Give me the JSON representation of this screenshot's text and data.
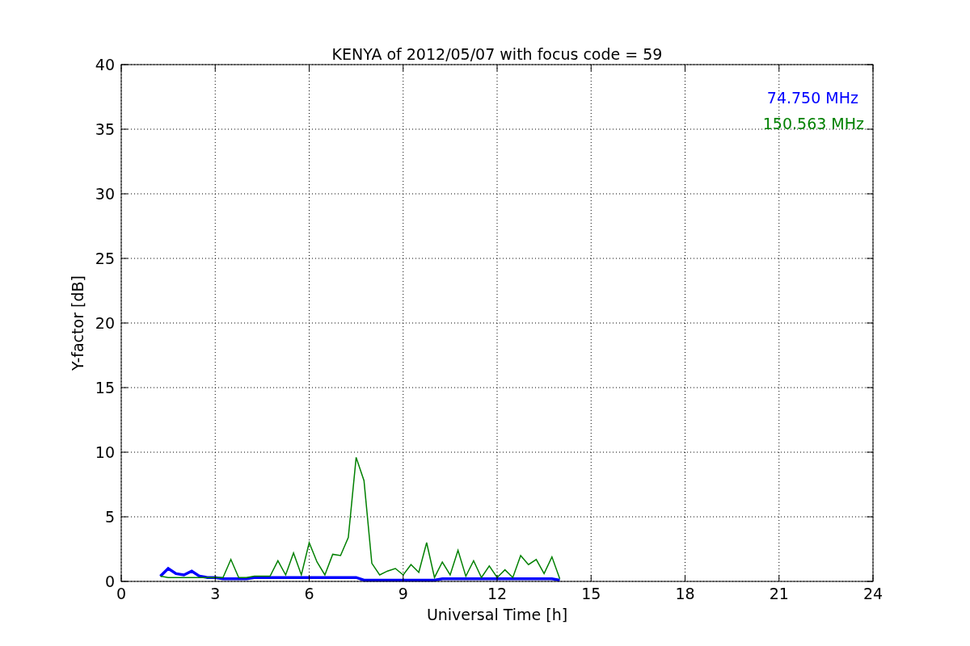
{
  "figure": {
    "chart_data": {
      "type": "line",
      "title": "KENYA of 2012/05/07 with focus code = 59",
      "xlabel": "Universal Time [h]",
      "ylabel": "Y-factor [dB]",
      "x": [
        1.25,
        1.5,
        1.75,
        2.0,
        2.25,
        2.5,
        2.75,
        3.0,
        3.25,
        3.5,
        3.75,
        4.0,
        4.25,
        4.5,
        4.75,
        5.0,
        5.25,
        5.5,
        5.75,
        6.0,
        6.25,
        6.5,
        6.75,
        7.0,
        7.25,
        7.5,
        7.75,
        8.0,
        8.25,
        8.5,
        8.75,
        9.0,
        9.25,
        9.5,
        9.75,
        10.0,
        10.25,
        10.5,
        10.75,
        11.0,
        11.25,
        11.5,
        11.75,
        12.0,
        12.25,
        12.5,
        12.75,
        13.0,
        13.25,
        13.5,
        13.75,
        14.0
      ],
      "series": [
        {
          "name": "74.750 MHz",
          "color": "#0000ff",
          "values": [
            0.4,
            1.0,
            0.6,
            0.5,
            0.8,
            0.4,
            0.3,
            0.3,
            0.2,
            0.2,
            0.2,
            0.2,
            0.3,
            0.3,
            0.3,
            0.3,
            0.3,
            0.3,
            0.3,
            0.3,
            0.3,
            0.3,
            0.3,
            0.3,
            0.3,
            0.3,
            0.1,
            0.1,
            0.1,
            0.1,
            0.1,
            0.1,
            0.1,
            0.1,
            0.1,
            0.1,
            0.2,
            0.2,
            0.2,
            0.2,
            0.2,
            0.2,
            0.2,
            0.2,
            0.2,
            0.2,
            0.2,
            0.2,
            0.2,
            0.2,
            0.2,
            0.1
          ]
        },
        {
          "name": "150.563 MHz",
          "color": "#008000",
          "values": [
            0.4,
            0.3,
            0.3,
            0.3,
            0.3,
            0.3,
            0.3,
            0.3,
            0.3,
            1.7,
            0.3,
            0.3,
            0.4,
            0.4,
            0.4,
            1.6,
            0.5,
            2.2,
            0.5,
            3.0,
            1.5,
            0.5,
            2.1,
            2.0,
            3.4,
            9.6,
            7.8,
            1.4,
            0.5,
            0.8,
            1.0,
            0.5,
            1.3,
            0.7,
            3.0,
            0.3,
            1.5,
            0.5,
            2.4,
            0.4,
            1.6,
            0.3,
            1.2,
            0.3,
            0.9,
            0.3,
            2.0,
            1.3,
            1.7,
            0.6,
            1.9,
            0.2
          ]
        }
      ],
      "grid": true,
      "xlim": [
        0,
        24
      ],
      "ylim": [
        0,
        40
      ],
      "xticks": [
        0,
        3,
        6,
        9,
        12,
        15,
        18,
        21,
        24
      ],
      "yticks": [
        0,
        5,
        10,
        15,
        20,
        25,
        30,
        35,
        40
      ]
    }
  }
}
